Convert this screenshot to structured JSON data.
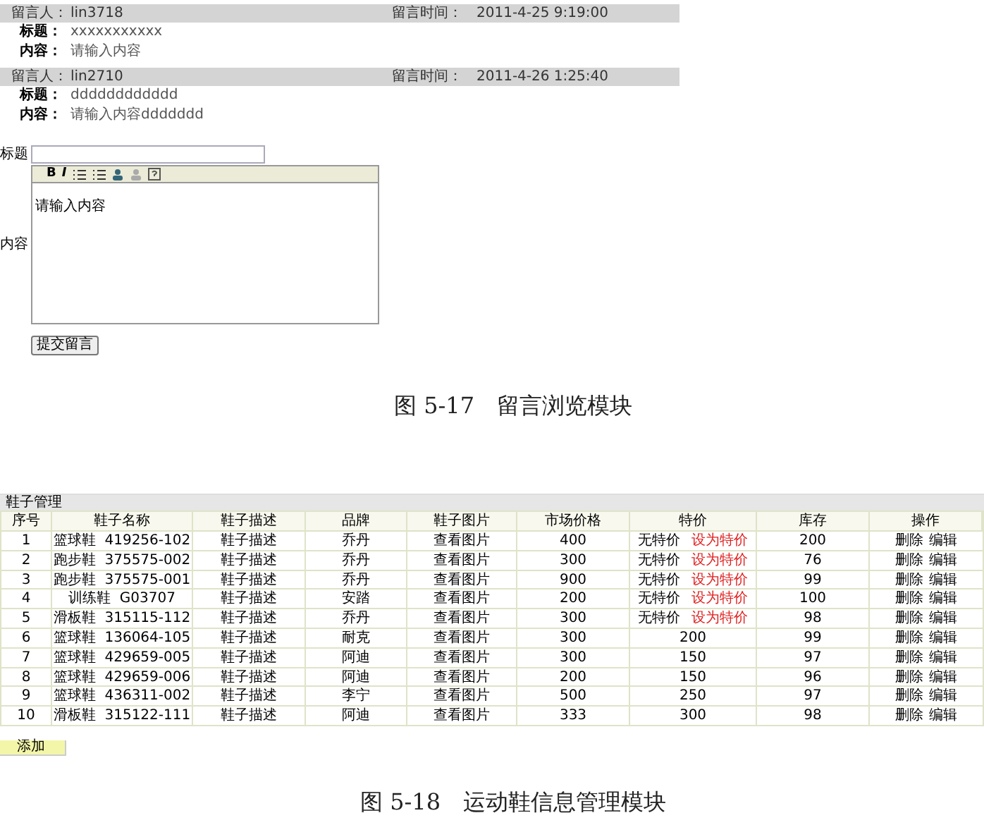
{
  "messages": [
    {
      "author_label": "留言人：",
      "author": "lin3718",
      "time_label": "留言时间：",
      "time": "2011-4-25 9:19:00",
      "title_label": "标题：",
      "title": "xxxxxxxxxxx",
      "content_label": "内容：",
      "content": "请输入内容"
    },
    {
      "author_label": "留言人：",
      "author": "lin2710",
      "time_label": "留言时间：",
      "time": "2011-4-26 1:25:40",
      "title_label": "标题：",
      "title": "dddddddddddd",
      "content_label": "内容：",
      "content": "请输入内容ddddddd"
    }
  ],
  "form": {
    "title_label": "标题",
    "content_label": "内容",
    "toolbar": [
      "B",
      "I"
    ],
    "editor_value": "请输入内容",
    "submit": "提交留言"
  },
  "caption_1": "图 5-17　留言浏览模块",
  "table": {
    "title": "鞋子管理",
    "columns": [
      "序号",
      "鞋子名称",
      "鞋子描述",
      "品牌",
      "鞋子图片",
      "市场价格",
      "特价",
      "库存",
      "操作"
    ],
    "rows": [
      {
        "no": "1",
        "name": "篮球鞋  419256-102",
        "desc": "鞋子描述",
        "brand": "乔丹",
        "image": "查看图片",
        "price": "400",
        "special": {
          "kind": "none",
          "text": "无特价",
          "link": "设为特价"
        },
        "stock": "200",
        "delete": "删除",
        "edit": "编辑"
      },
      {
        "no": "2",
        "name": "跑步鞋  375575-002",
        "desc": "鞋子描述",
        "brand": "乔丹",
        "image": "查看图片",
        "price": "300",
        "special": {
          "kind": "none",
          "text": "无特价",
          "link": "设为特价"
        },
        "stock": "76",
        "delete": "删除",
        "edit": "编辑"
      },
      {
        "no": "3",
        "name": "跑步鞋  375575-001",
        "desc": "鞋子描述",
        "brand": "乔丹",
        "image": "查看图片",
        "price": "900",
        "special": {
          "kind": "none",
          "text": "无特价",
          "link": "设为特价"
        },
        "stock": "99",
        "delete": "删除",
        "edit": "编辑"
      },
      {
        "no": "4",
        "name": "训练鞋  G03707",
        "desc": "鞋子描述",
        "brand": "安踏",
        "image": "查看图片",
        "price": "200",
        "special": {
          "kind": "none",
          "text": "无特价",
          "link": "设为特价"
        },
        "stock": "100",
        "delete": "删除",
        "edit": "编辑"
      },
      {
        "no": "5",
        "name": "滑板鞋  315115-112",
        "desc": "鞋子描述",
        "brand": "乔丹",
        "image": "查看图片",
        "price": "300",
        "special": {
          "kind": "none",
          "text": "无特价",
          "link": "设为特价"
        },
        "stock": "98",
        "delete": "删除",
        "edit": "编辑"
      },
      {
        "no": "6",
        "name": "篮球鞋  136064-105",
        "desc": "鞋子描述",
        "brand": "耐克",
        "image": "查看图片",
        "price": "300",
        "special": {
          "kind": "price",
          "text": "200"
        },
        "stock": "99",
        "delete": "删除",
        "edit": "编辑"
      },
      {
        "no": "7",
        "name": "篮球鞋  429659-005",
        "desc": "鞋子描述",
        "brand": "阿迪",
        "image": "查看图片",
        "price": "300",
        "special": {
          "kind": "price",
          "text": "150"
        },
        "stock": "97",
        "delete": "删除",
        "edit": "编辑"
      },
      {
        "no": "8",
        "name": "篮球鞋  429659-006",
        "desc": "鞋子描述",
        "brand": "阿迪",
        "image": "查看图片",
        "price": "200",
        "special": {
          "kind": "price",
          "text": "150"
        },
        "stock": "96",
        "delete": "删除",
        "edit": "编辑"
      },
      {
        "no": "9",
        "name": "篮球鞋  436311-002",
        "desc": "鞋子描述",
        "brand": "李宁",
        "image": "查看图片",
        "price": "500",
        "special": {
          "kind": "price",
          "text": "250"
        },
        "stock": "97",
        "delete": "删除",
        "edit": "编辑"
      },
      {
        "no": "10",
        "name": "滑板鞋  315122-111",
        "desc": "鞋子描述",
        "brand": "阿迪",
        "image": "查看图片",
        "price": "333",
        "special": {
          "kind": "price",
          "text": "300"
        },
        "stock": "98",
        "delete": "删除",
        "edit": "编辑"
      }
    ],
    "add": "添加"
  },
  "caption_2": "图 5-18　运动鞋信息管理模块"
}
